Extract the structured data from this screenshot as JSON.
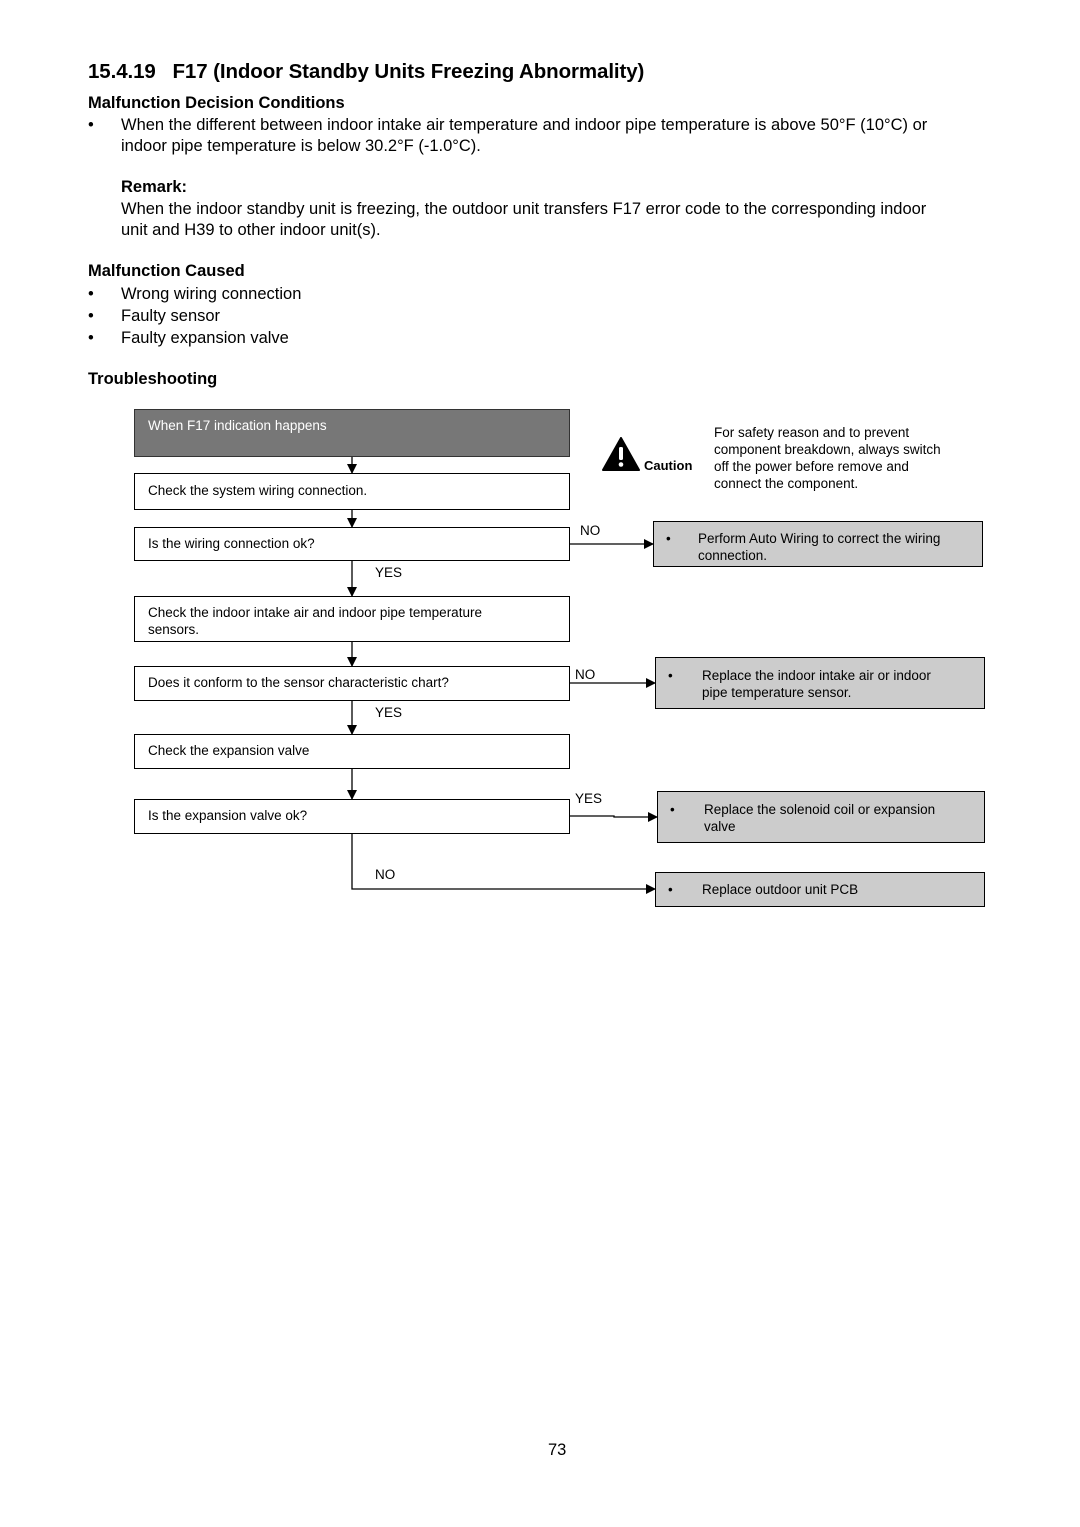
{
  "section": {
    "number": "15.4.19",
    "title": "F17 (Indoor Standby Units Freezing Abnormality)"
  },
  "decision_conditions": {
    "heading": "Malfunction Decision Conditions",
    "bullet": "•",
    "items": [
      {
        "line1": "When the different between indoor intake air temperature and indoor pipe temperature is above 50°F (10°C) or",
        "line2": "indoor pipe temperature is below 30.2°F (-1.0°C)."
      }
    ],
    "remark_heading": "Remark:",
    "remark_line1": "When the indoor standby unit is freezing, the outdoor unit transfers F17 error code to the corresponding indoor",
    "remark_line2": "unit and H39 to other indoor unit(s)."
  },
  "malfunction_caused": {
    "heading": "Malfunction Caused",
    "items": [
      "Wrong wiring connection",
      "Faulty sensor",
      "Faulty expansion valve"
    ]
  },
  "troubleshooting": {
    "heading": "Troubleshooting",
    "caution": {
      "label": "Caution",
      "icon": "warning-triangle-icon",
      "lines": [
        "For safety reason and to prevent",
        "component breakdown, always switch",
        "off the power before remove and",
        "connect the component."
      ]
    },
    "steps": [
      {
        "text": "When F17 indication happens"
      },
      {
        "text": "Check the system wiring connection."
      },
      {
        "text": "Is the wiring connection ok?"
      },
      {
        "line1": "Check the indoor intake air and indoor pipe temperature",
        "line2": "sensors."
      },
      {
        "text": "Does it conform to the sensor characteristic chart?"
      },
      {
        "text": "Check the expansion valve"
      },
      {
        "text": "Is the expansion valve ok?"
      }
    ],
    "results": [
      {
        "bullet": "•",
        "line1": "Perform Auto Wiring to correct the wiring",
        "line2": "connection."
      },
      {
        "bullet": "•",
        "line1": "Replace the indoor intake air or indoor",
        "line2": "pipe temperature sensor."
      },
      {
        "bullet": "•",
        "line1": "Replace the solenoid coil or expansion",
        "line2": "valve"
      },
      {
        "bullet": "•",
        "line1": "Replace outdoor unit PCB"
      }
    ],
    "labels": {
      "no1": "NO",
      "yes1": "YES",
      "no2": "NO",
      "yes2": "YES",
      "yes3": "YES",
      "no3": "NO"
    }
  },
  "page_number": "73"
}
